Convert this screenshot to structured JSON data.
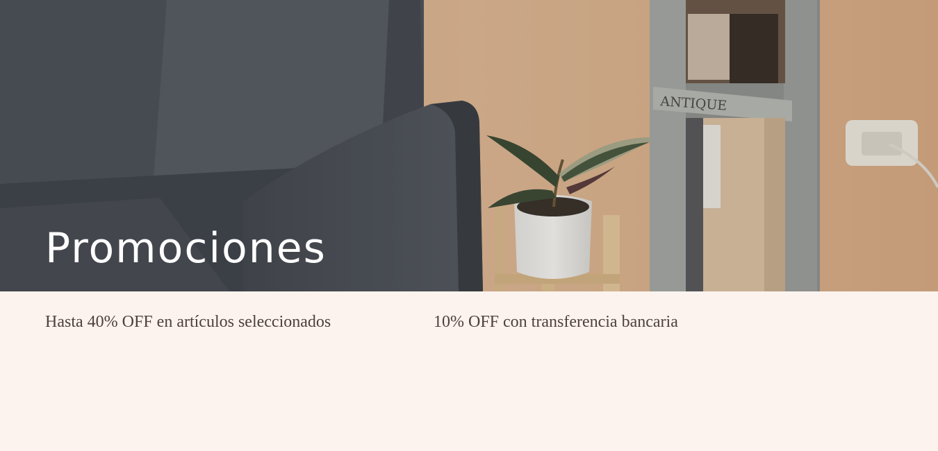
{
  "hero": {
    "title": "Promociones",
    "image_text": "ANTIQUE",
    "colors": {
      "wall": "#d9b28f",
      "sofa": "#4b4f55",
      "mirror_frame": "#9ea09c",
      "text": "#ffffff"
    }
  },
  "promotions": [
    {
      "text": "Hasta 40% OFF en artículos seleccionados"
    },
    {
      "text": "10% OFF con transferencia bancaria"
    }
  ],
  "colors": {
    "page_background": "#fdf3ee",
    "promo_text": "#4e403a"
  }
}
